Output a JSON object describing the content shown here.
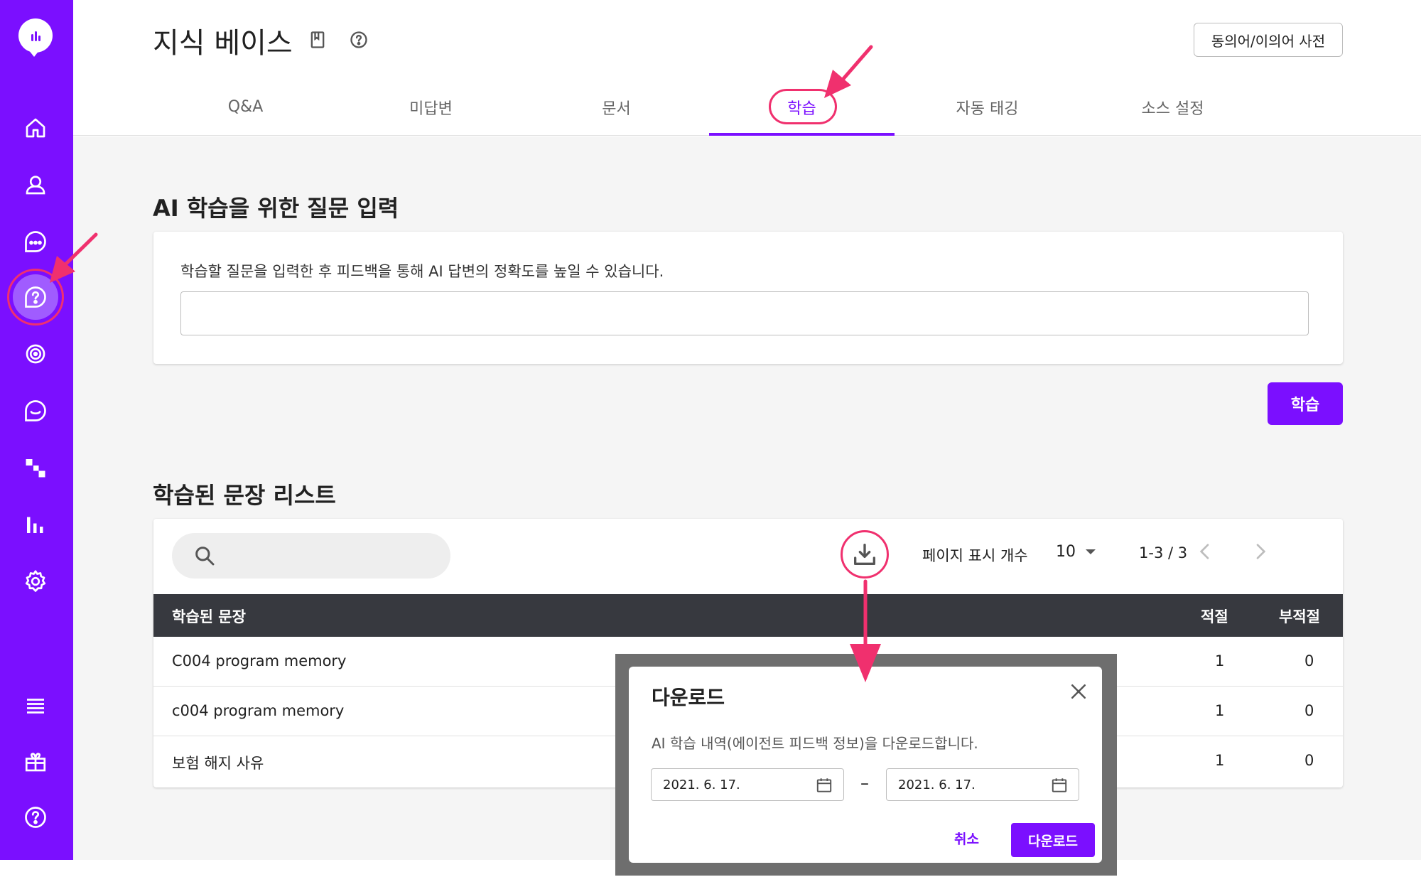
{
  "header": {
    "title": "지식 베이스",
    "dict_button": "동의어/이의어 사전"
  },
  "tabs": [
    {
      "label": "Q&A"
    },
    {
      "label": "미답변"
    },
    {
      "label": "문서"
    },
    {
      "label": "학습",
      "active": true
    },
    {
      "label": "자동 태깅"
    },
    {
      "label": "소스 설정"
    }
  ],
  "train_section": {
    "title": "AI 학습을 위한 질문 입력",
    "help_text": "학습할 질문을 입력한 후 피드백을 통해 AI 답변의 정확도를 높일 수 있습니다.",
    "input_value": "",
    "button": "학습"
  },
  "list_section": {
    "title": "학습된 문장 리스트",
    "search_value": "",
    "page_size_label": "페이지 표시 개수",
    "page_size": "10",
    "range": "1-3 / 3",
    "columns": [
      "학습된 문장",
      "적절",
      "부적절"
    ],
    "rows": [
      {
        "sentence": "C004 program memory",
        "good": "1",
        "bad": "0"
      },
      {
        "sentence": "c004 program memory",
        "good": "1",
        "bad": "0"
      },
      {
        "sentence": "보험 해지 사유",
        "good": "1",
        "bad": "0"
      }
    ]
  },
  "modal": {
    "title": "다운로드",
    "description": "AI 학습 내역(에이전트 피드백 정보)을 다운로드합니다.",
    "start_date": "2021. 6. 17.",
    "dash": "–",
    "end_date": "2021. 6. 17.",
    "cancel": "취소",
    "confirm": "다운로드"
  },
  "colors": {
    "brand": "#7b0fff",
    "annotation": "#f0306e",
    "table_header": "#37393f"
  }
}
